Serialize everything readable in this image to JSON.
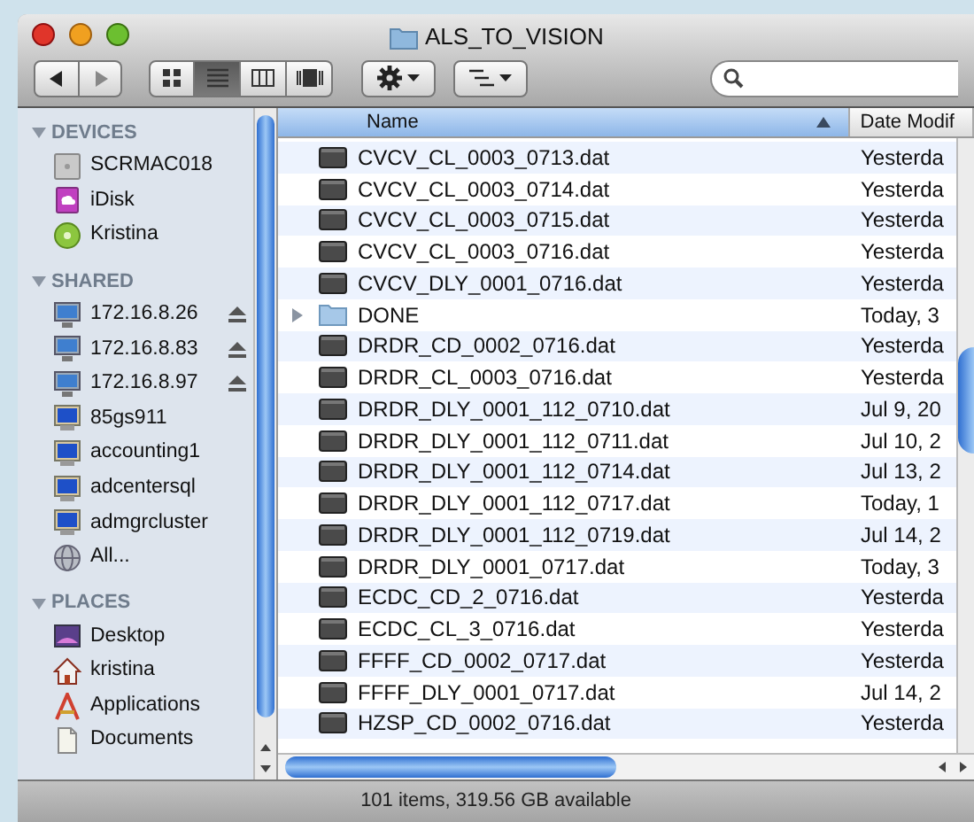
{
  "window": {
    "title": "ALS_TO_VISION"
  },
  "toolbar": {
    "view_modes": [
      {
        "kind": "icons",
        "selected": false
      },
      {
        "kind": "list",
        "selected": true
      },
      {
        "kind": "columns",
        "selected": false
      },
      {
        "kind": "coverflow",
        "selected": false
      }
    ]
  },
  "sidebar": {
    "sections": [
      {
        "heading": "DEVICES",
        "expanded": true,
        "items": [
          {
            "label": "SCRMAC018",
            "kind": "drive",
            "eject": false
          },
          {
            "label": "iDisk",
            "kind": "idisk",
            "eject": false
          },
          {
            "label": "Kristina",
            "kind": "disc",
            "eject": false
          }
        ]
      },
      {
        "heading": "SHARED",
        "expanded": true,
        "items": [
          {
            "label": "172.16.8.26",
            "kind": "monitor",
            "eject": true
          },
          {
            "label": "172.16.8.83",
            "kind": "monitor",
            "eject": true
          },
          {
            "label": "172.16.8.97",
            "kind": "monitor",
            "eject": true
          },
          {
            "label": "85gs911",
            "kind": "server",
            "eject": false
          },
          {
            "label": "accounting1",
            "kind": "server",
            "eject": false
          },
          {
            "label": "adcentersql",
            "kind": "server",
            "eject": false
          },
          {
            "label": "admgrcluster",
            "kind": "server",
            "eject": false
          },
          {
            "label": "All...",
            "kind": "network",
            "eject": false
          }
        ]
      },
      {
        "heading": "PLACES",
        "expanded": true,
        "items": [
          {
            "label": "Desktop",
            "kind": "desktop",
            "eject": false
          },
          {
            "label": "kristina",
            "kind": "home",
            "eject": false
          },
          {
            "label": "Applications",
            "kind": "apps",
            "eject": false
          },
          {
            "label": "Documents",
            "kind": "documents",
            "eject": false
          }
        ]
      }
    ]
  },
  "columns": [
    {
      "label": "Name",
      "sorted": true
    },
    {
      "label": "Date Modif",
      "sorted": false
    }
  ],
  "rows": [
    {
      "name": "CVCV_CL_0003_0713.dat",
      "kind": "file",
      "date": "Yesterda"
    },
    {
      "name": "CVCV_CL_0003_0714.dat",
      "kind": "file",
      "date": "Yesterda"
    },
    {
      "name": "CVCV_CL_0003_0715.dat",
      "kind": "file",
      "date": "Yesterda"
    },
    {
      "name": "CVCV_CL_0003_0716.dat",
      "kind": "file",
      "date": "Yesterda"
    },
    {
      "name": "CVCV_DLY_0001_0716.dat",
      "kind": "file",
      "date": "Yesterda"
    },
    {
      "name": "DONE",
      "kind": "folder",
      "date": "Today, 3"
    },
    {
      "name": "DRDR_CD_0002_0716.dat",
      "kind": "file",
      "date": "Yesterda"
    },
    {
      "name": "DRDR_CL_0003_0716.dat",
      "kind": "file",
      "date": "Yesterda"
    },
    {
      "name": "DRDR_DLY_0001_112_0710.dat",
      "kind": "file",
      "date": "Jul 9, 20"
    },
    {
      "name": "DRDR_DLY_0001_112_0711.dat",
      "kind": "file",
      "date": "Jul 10, 2"
    },
    {
      "name": "DRDR_DLY_0001_112_0714.dat",
      "kind": "file",
      "date": "Jul 13, 2"
    },
    {
      "name": "DRDR_DLY_0001_112_0717.dat",
      "kind": "file",
      "date": "Today, 1"
    },
    {
      "name": "DRDR_DLY_0001_112_0719.dat",
      "kind": "file",
      "date": "Jul 14, 2"
    },
    {
      "name": "DRDR_DLY_0001_0717.dat",
      "kind": "file",
      "date": "Today, 3"
    },
    {
      "name": "ECDC_CD_2_0716.dat",
      "kind": "file",
      "date": "Yesterda"
    },
    {
      "name": "ECDC_CL_3_0716.dat",
      "kind": "file",
      "date": "Yesterda"
    },
    {
      "name": "FFFF_CD_0002_0717.dat",
      "kind": "file",
      "date": "Yesterda"
    },
    {
      "name": "FFFF_DLY_0001_0717.dat",
      "kind": "file",
      "date": "Jul 14, 2"
    },
    {
      "name": "HZSP_CD_0002_0716.dat",
      "kind": "file",
      "date": "Yesterda"
    }
  ],
  "status_bar": "101 items, 319.56 GB available"
}
